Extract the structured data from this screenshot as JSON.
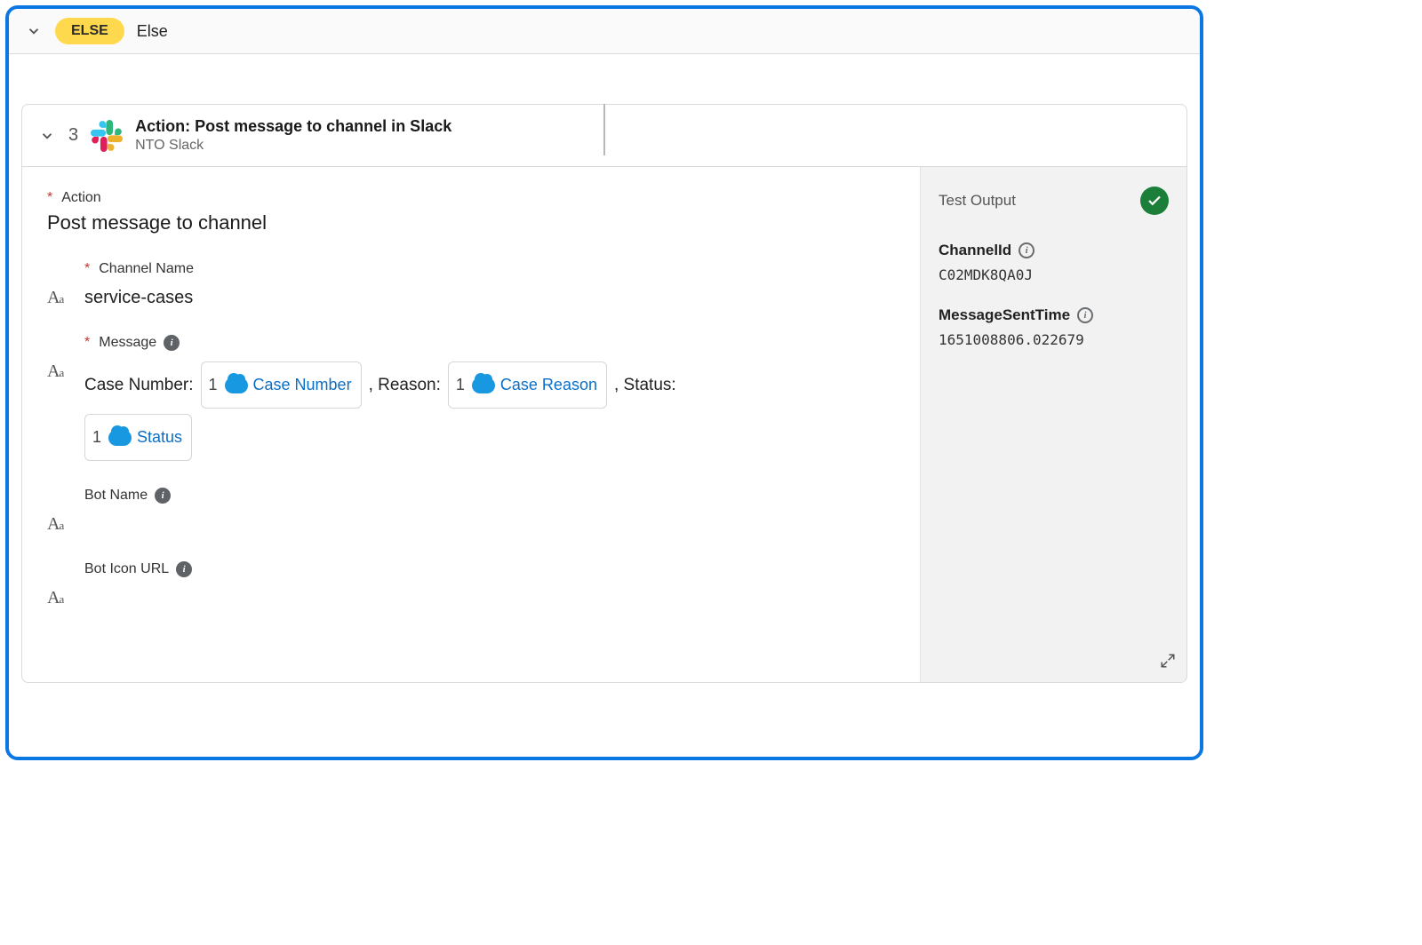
{
  "elseBar": {
    "pill": "ELSE",
    "text": "Else"
  },
  "card": {
    "stepNumber": "3",
    "title": "Action: Post message to channel in Slack",
    "subtitle": "NTO Slack"
  },
  "action": {
    "label": "Action",
    "value": "Post message to channel"
  },
  "channelName": {
    "label": "Channel Name",
    "value": "service-cases"
  },
  "message": {
    "label": "Message",
    "prefixCase": "Case Number:",
    "pillCaseNum": {
      "num": "1",
      "label": "Case Number"
    },
    "sepReason": ", Reason:",
    "pillReason": {
      "num": "1",
      "label": "Case Reason"
    },
    "sepStatus": ", Status:",
    "pillStatus": {
      "num": "1",
      "label": "Status"
    }
  },
  "botName": {
    "label": "Bot Name"
  },
  "botIcon": {
    "label": "Bot Icon URL"
  },
  "testOutput": {
    "heading": "Test Output",
    "channelIdLabel": "ChannelId",
    "channelIdValue": "C02MDK8QA0J",
    "msgTimeLabel": "MessageSentTime",
    "msgTimeValue": "1651008806.022679"
  }
}
